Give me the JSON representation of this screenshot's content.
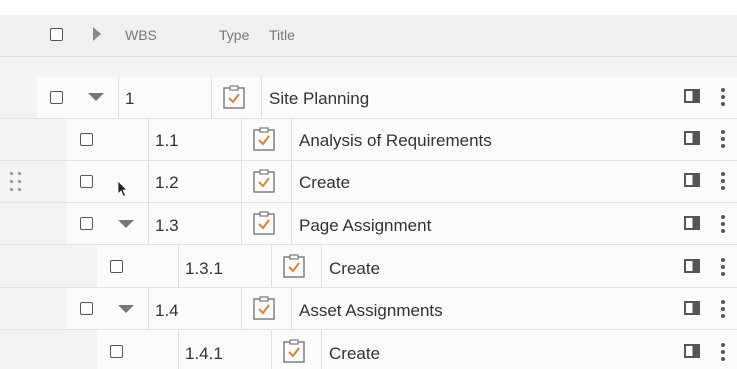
{
  "header": {
    "wbs_label": "WBS",
    "type_label": "Type",
    "title_label": "Title"
  },
  "rows": [
    {
      "wbs": "1",
      "title": "Site Planning",
      "expanded": true
    },
    {
      "wbs": "1.1",
      "title": "Analysis of Requirements"
    },
    {
      "wbs": "1.2",
      "title": "Create"
    },
    {
      "wbs": "1.3",
      "title": "Page Assignment",
      "expanded": true
    },
    {
      "wbs": "1.3.1",
      "title": "Create"
    },
    {
      "wbs": "1.4",
      "title": "Asset Assignments",
      "expanded": true
    },
    {
      "wbs": "1.4.1",
      "title": "Create"
    }
  ],
  "icons": {
    "task": "clipboard-check-icon",
    "panel": "side-panel-icon",
    "menu": "kebab-menu-icon",
    "drag": "drag-handle-icon"
  },
  "colors": {
    "task_icon": "#c8893a",
    "row_bg": "#fbfbfb",
    "header_bg": "#f0f0f0"
  }
}
